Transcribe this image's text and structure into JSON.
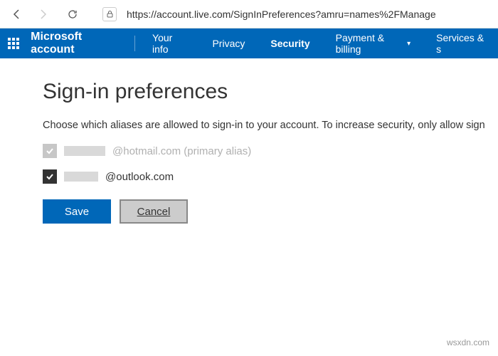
{
  "browser": {
    "url": "https://account.live.com/SignInPreferences?amru=names%2FManage"
  },
  "header": {
    "brand": "Microsoft account",
    "nav": {
      "your_info": "Your info",
      "privacy": "Privacy",
      "security": "Security",
      "payment": "Payment & billing",
      "services": "Services & s"
    }
  },
  "page": {
    "title": "Sign-in preferences",
    "intro": "Choose which aliases are allowed to sign-in to your account. To increase security, only allow sign"
  },
  "aliases": {
    "primary_suffix": "@hotmail.com (primary alias)",
    "secondary_suffix": "@outlook.com"
  },
  "buttons": {
    "save": "Save",
    "cancel": "Cancel"
  },
  "watermark": "wsxdn.com"
}
